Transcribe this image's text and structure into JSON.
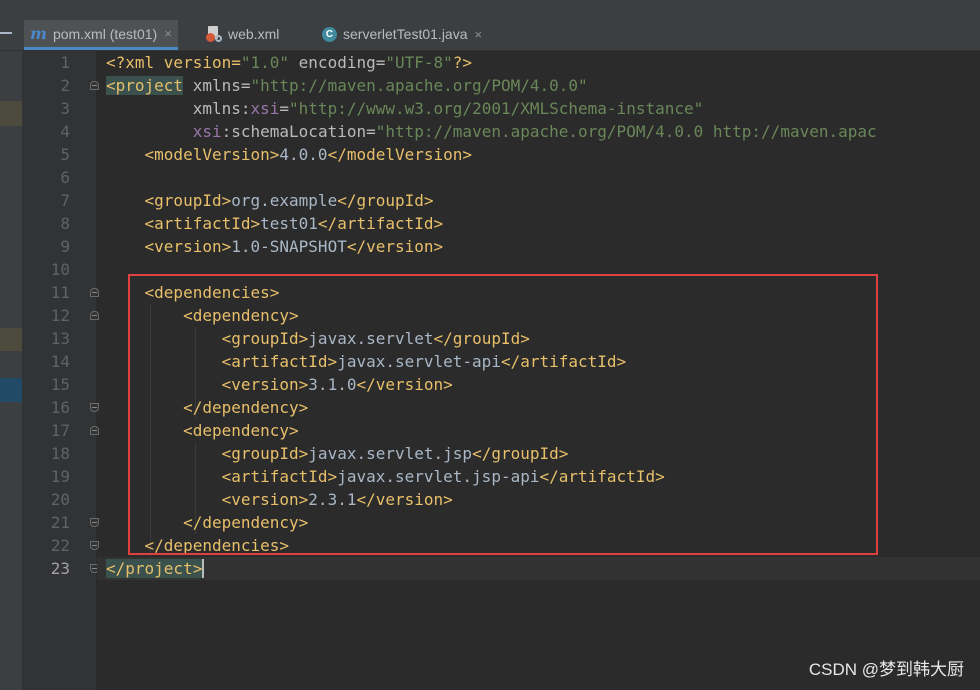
{
  "tabs": [
    {
      "label": "pom.xml (test01)",
      "icon": "maven-m-icon",
      "active": true,
      "close": "×"
    },
    {
      "label": "web.xml",
      "icon": "web-xml-icon",
      "active": false,
      "close": ""
    },
    {
      "label": "serverletTest01.java",
      "icon": "java-class-icon",
      "active": false,
      "close": "×"
    }
  ],
  "editor": {
    "current_line": 23,
    "line_numbers": [
      "1",
      "2",
      "3",
      "4",
      "5",
      "6",
      "7",
      "8",
      "9",
      "10",
      "11",
      "12",
      "13",
      "14",
      "15",
      "16",
      "17",
      "18",
      "19",
      "20",
      "21",
      "22",
      "23"
    ]
  },
  "code": {
    "l1": {
      "a": "<?xml version=",
      "b": "\"1.0\"",
      "c": " encoding=",
      "d": "\"UTF-8\"",
      "e": "?>"
    },
    "l2": {
      "a": "<project",
      "b": " xmlns=",
      "c": "\"http://maven.apache.org/POM/4.0.0\""
    },
    "l3": {
      "a": "xmlns:",
      "b": "xsi",
      "c": "=",
      "d": "\"http://www.w3.org/2001/XMLSchema-instance\""
    },
    "l4": {
      "a": "xsi",
      "b": ":schemaLocation=",
      "c": "\"http://maven.apache.org/POM/4.0.0 http://maven.apac"
    },
    "l5": {
      "a": "<modelVersion>",
      "b": "4.0.0",
      "c": "</modelVersion>"
    },
    "l7": {
      "a": "<groupId>",
      "b": "org.example",
      "c": "</groupId>"
    },
    "l8": {
      "a": "<artifactId>",
      "b": "test01",
      "c": "</artifactId>"
    },
    "l9": {
      "a": "<version>",
      "b": "1.0-SNAPSHOT",
      "c": "</version>"
    },
    "l11": {
      "a": "<dependencies>"
    },
    "l12": {
      "a": "<dependency>"
    },
    "l13": {
      "a": "<groupId>",
      "b": "javax.servlet",
      "c": "</groupId>"
    },
    "l14": {
      "a": "<artifactId>",
      "b": "javax.servlet-api",
      "c": "</artifactId>"
    },
    "l15": {
      "a": "<version>",
      "b": "3.1.0",
      "c": "</version>"
    },
    "l16": {
      "a": "</dependency>"
    },
    "l17": {
      "a": "<dependency>"
    },
    "l18": {
      "a": "<groupId>",
      "b": "javax.servlet.jsp",
      "c": "</groupId>"
    },
    "l19": {
      "a": "<artifactId>",
      "b": "javax.servlet.jsp-api",
      "c": "</artifactId>"
    },
    "l20": {
      "a": "<version>",
      "b": "2.3.1",
      "c": "</version>"
    },
    "l21": {
      "a": "</dependency>"
    },
    "l22": {
      "a": "</dependencies>"
    },
    "l23": {
      "a": "</project>"
    }
  },
  "watermark": "CSDN @梦到韩大厨",
  "colors": {
    "background": "#2b2b2b",
    "tag": "#e8bf6a",
    "string": "#6a8759",
    "namespace": "#9876aa",
    "highlight_box": "#e0413f"
  }
}
